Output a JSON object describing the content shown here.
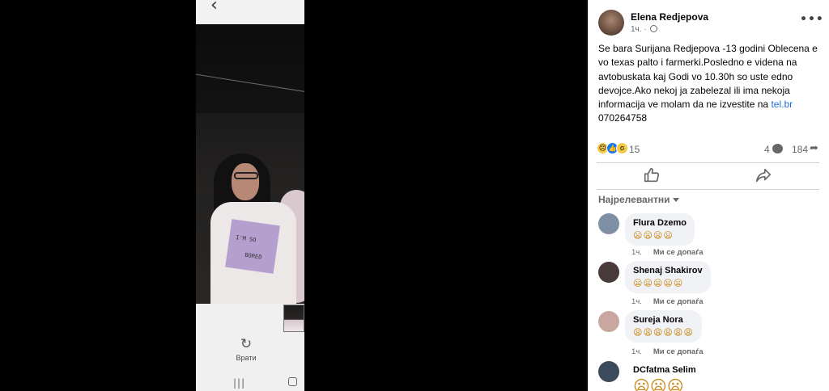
{
  "viewer": {
    "back_icon": "chevron-left-icon",
    "photo_text_line1": "I'M SO",
    "photo_text_line2": "BORED",
    "revert_label": "Врати",
    "nav_recent_glyph": "|||"
  },
  "post": {
    "author": "Elena Redjepova",
    "time": "1ч. ·",
    "text_main": "Se bara Surijana Redjepova -13 godini Oblecena e vo texas palto i farmerki.Posledno e videna na avtobuskata kaj Godi vo 10.30h so uste edno devojce.Ako nekoj ja zabelezal ili ima nekoja informacija ve molam da ne izvestite na ",
    "link": "tel.br",
    "text_after_link": " 070264758",
    "reaction_count": "15",
    "comment_count": "4",
    "share_count": "184",
    "reaction_icons": [
      "sad-react-icon",
      "like-react-icon",
      "wow-react-icon"
    ]
  },
  "comments_header": {
    "sort_label": "Најрелевантни"
  },
  "comments": [
    {
      "name": "Flura Dzemo",
      "text": "😦😦😦😦",
      "time": "1ч.",
      "like": "Ми се допаѓа",
      "avatar_color": "#7f8fa6"
    },
    {
      "name": "Shenaj Shakirov",
      "text": "😦😦😦😦😦",
      "time": "1ч.",
      "like": "Ми се допаѓа",
      "avatar_color": "#4a3b3b"
    },
    {
      "name": "Sureja Nora",
      "text": "😩😩😩😩😩😩",
      "time": "1ч.",
      "like": "Ми се допаѓа",
      "avatar_color": "#c9a7a0"
    },
    {
      "name": "DCfatma Selim",
      "text": "😦😦😦",
      "time": "",
      "like": "",
      "avatar_color": "#3d4a5c"
    }
  ],
  "colors": {
    "link": "#216fdb",
    "muted": "#65676b",
    "bubble": "#f0f2f5",
    "like_blue": "#1877f2"
  }
}
